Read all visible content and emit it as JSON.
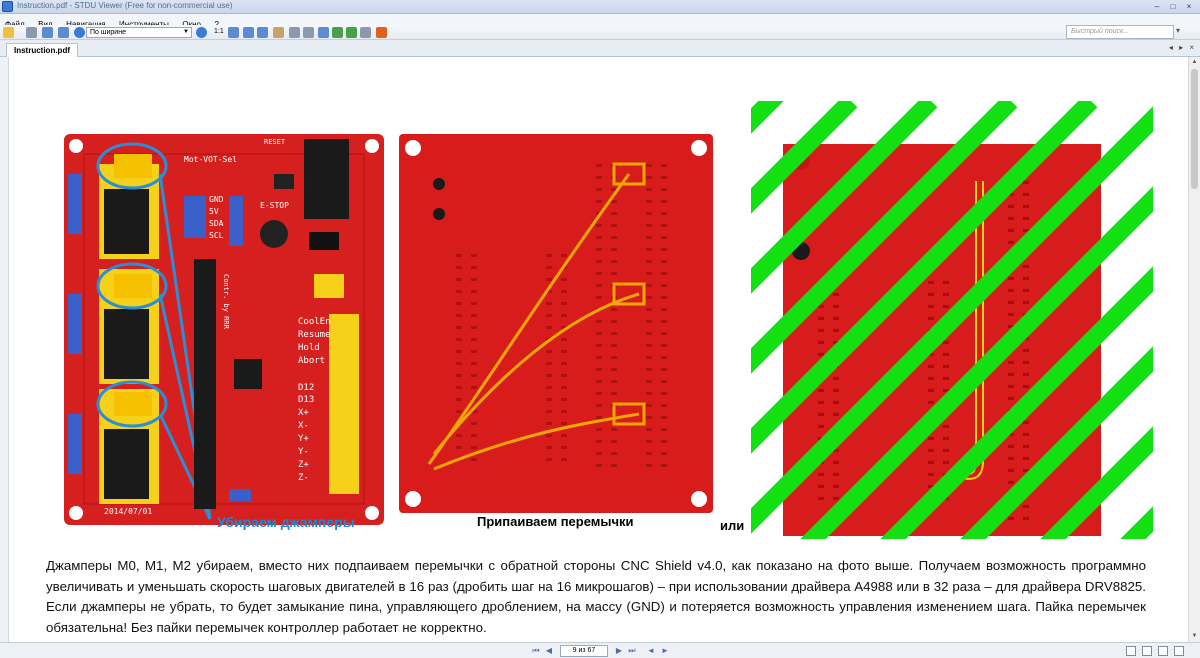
{
  "window": {
    "title": "Instruction.pdf - STDU Viewer (Free for non-commercial use)",
    "controls": [
      "–",
      "□",
      "×"
    ]
  },
  "menu": [
    "Файл",
    "Вид",
    "Навигация",
    "Инструменты",
    "Окно",
    "?"
  ],
  "toolbar": {
    "zoom_mode": "По ширине",
    "page_size_label": "1:1",
    "search_placeholder": "Быстрый поиск..."
  },
  "tab": {
    "label": "Instruction.pdf"
  },
  "document": {
    "caption_left": "Убираем джамперы",
    "caption_middle": "Припаиваем перемычки",
    "caption_or": "или",
    "paragraph": "Джамперы M0, M1, M2 убираем, вместо них подпаиваем перемычки с обратной стороны CNC Shield v4.0, как показано на фото выше. Получаем возможность программно увеличивать и уменьшать скорость шаговых двигателей в 16 раз (дробить шаг на 16 микрошагов) – при использовании драйвера A4988 или в 32 раза – для драйвера DRV8825. Если джамперы не убрать, то будет замыкание пина, управляющего дроблением, на массу (GND) и потеряется возможность управления изменением шага. Пайка перемычек обязательна! Без пайки перемычек контроллер работает не корректно.",
    "board_labels": {
      "top_left": "Mot-VOT-Sel",
      "reset": "RESET",
      "estop": "E-STOP",
      "i2c": [
        "GND",
        "5V",
        "SDA",
        "SCL"
      ],
      "pins_right": [
        "CoolEn",
        "Resume",
        "Hold",
        "Abort"
      ],
      "pins_d": [
        "D12",
        "D13",
        "X+",
        "X-",
        "Y+",
        "Y-",
        "Z+",
        "Z-"
      ],
      "date": "2014/07/01",
      "credit": "Contr. by RRR"
    }
  },
  "status": {
    "page_indicator": "9 из 67"
  },
  "colors": {
    "pcb_red": "#d62020",
    "jumper_yellow": "#f5d11a",
    "highlight_blue": "#2a8fd4",
    "wire_orange": "#f0a800",
    "stripe_green": "#12e012",
    "caption_blue": "#1a8ad6"
  }
}
